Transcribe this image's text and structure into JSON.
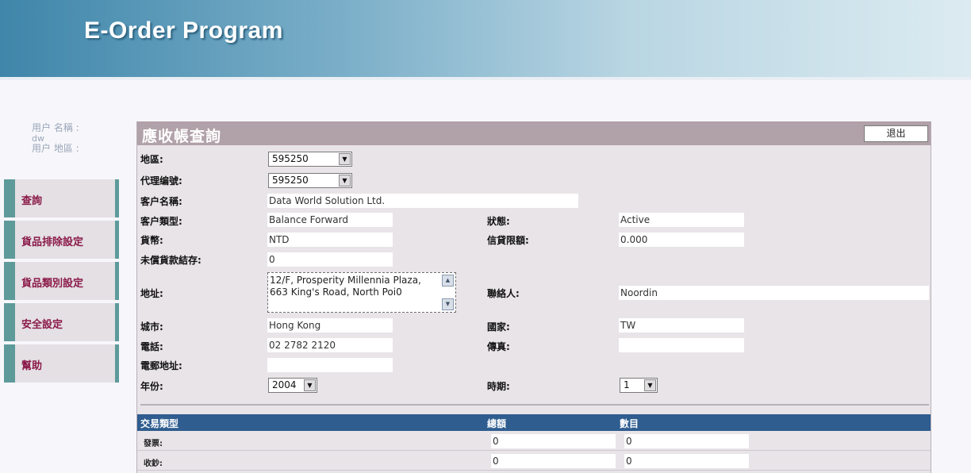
{
  "app": {
    "title": "E-Order Program"
  },
  "user": {
    "name_label": "用户 名稱 :",
    "name_value": "dw",
    "region_label": "用户 地區 :"
  },
  "nav": {
    "items": [
      {
        "label": "查詢"
      },
      {
        "label": "貨品排除設定"
      },
      {
        "label": "貨品類別設定"
      },
      {
        "label": "安全設定"
      },
      {
        "label": "幫助"
      }
    ]
  },
  "panel": {
    "title": "應收帳查詢",
    "logout_label": "退出"
  },
  "form": {
    "region_label": "地區:",
    "region_value": "595250",
    "agent_label": "代理编號:",
    "agent_value": "595250",
    "customer_name_label": "客户名稱:",
    "customer_name_value": "Data World Solution Ltd.",
    "customer_type_label": "客户類型:",
    "customer_type_value": "Balance Forward",
    "status_label": "狀態:",
    "status_value": "Active",
    "currency_label": "貨幣:",
    "currency_value": "NTD",
    "credit_limit_label": "信貸限額:",
    "credit_limit_value": "0.000",
    "unpaid_label": "未償貨款結存:",
    "unpaid_value": "0",
    "address_label": "地址:",
    "address_value": "12/F, Prosperity Millennia Plaza, 663 King's Road, North Poi0",
    "contact_label": "聯絡人:",
    "contact_value": "Noordin",
    "city_label": "城市:",
    "city_value": "Hong Kong",
    "country_label": "國家:",
    "country_value": "TW",
    "phone_label": "電話:",
    "phone_value": "02 2782 2120",
    "fax_label": "傳真:",
    "fax_value": "",
    "email_label": "電郵地址:",
    "email_value": "",
    "year_label": "年份:",
    "year_value": "2004",
    "period_label": "時期:",
    "period_value": "1"
  },
  "table": {
    "headers": {
      "type": "交易類型",
      "total": "總額",
      "count": "數目"
    },
    "rows": [
      {
        "label": "發票:",
        "total": "0",
        "count": "0"
      },
      {
        "label": "收鈔:",
        "total": "0",
        "count": "0"
      }
    ]
  },
  "icons": {
    "dropdown": "dropdown-arrow-icon",
    "scroll_up": "scroll-up-icon",
    "scroll_down": "scroll-down-icon"
  }
}
